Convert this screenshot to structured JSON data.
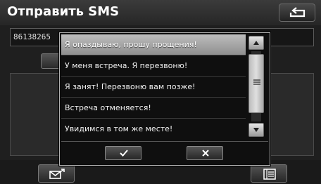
{
  "header": {
    "title": "Отправить SMS",
    "back_icon": "return-arrow-icon"
  },
  "recipient": {
    "value": "86138265"
  },
  "templates": {
    "items": [
      "Я опаздываю, прошу прощения!",
      "У меня встреча. Я перезвоню!",
      "Я занят! Перезвоню вам позже!",
      "Встреча отменяется!",
      "Увидимся в том же месте!"
    ],
    "selected_index": 0
  },
  "popup_actions": {
    "ok_icon": "checkmark-icon",
    "cancel_icon": "x-icon"
  },
  "bottom_bar": {
    "send_icon": "send-message-icon",
    "templates_icon": "template-list-icon"
  },
  "colors": {
    "background": "#1f1f1f",
    "selected_row": "#a8a8a8",
    "text": "#ffffff"
  }
}
